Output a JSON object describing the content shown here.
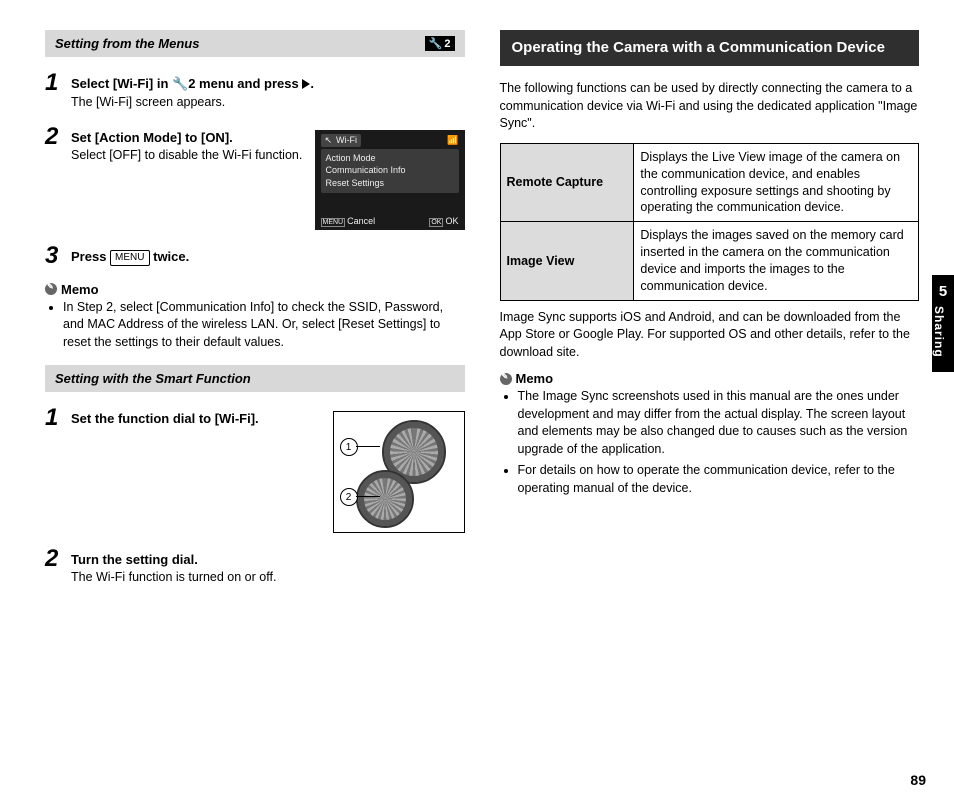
{
  "chapter_number": "5",
  "chapter_name": "Sharing",
  "page_number": "89",
  "left": {
    "section1": {
      "title": "Setting from the Menus",
      "badge_label": "2",
      "steps": [
        {
          "num": "1",
          "title_pre": "Select [Wi-Fi] in ",
          "title_mid": "2 menu and press ",
          "title_post": ".",
          "sub": "The [Wi-Fi] screen appears."
        },
        {
          "num": "2",
          "title": "Set [Action Mode] to [ON].",
          "sub": "Select [OFF] to disable the Wi-Fi function.",
          "lcd": {
            "title": "Wi-Fi",
            "items": [
              "Action Mode",
              "Communication Info",
              "Reset Settings"
            ],
            "cancel": "Cancel",
            "ok": "OK",
            "menu_btn": "MENU",
            "ok_btn": "OK"
          }
        },
        {
          "num": "3",
          "title_pre": "Press ",
          "title_post": " twice.",
          "menu_label": "MENU"
        }
      ],
      "memo_label": "Memo",
      "memo": "In Step 2, select [Communication Info] to check the SSID, Password, and MAC Address of the wireless LAN. Or, select [Reset Settings] to reset the settings to their default values."
    },
    "section2": {
      "title": "Setting with the Smart Function",
      "steps": [
        {
          "num": "1",
          "title": "Set the function dial to [Wi-Fi].",
          "callouts": [
            "1",
            "2"
          ]
        },
        {
          "num": "2",
          "title": "Turn the setting dial.",
          "sub": "The Wi-Fi function is turned on or off."
        }
      ]
    }
  },
  "right": {
    "heading": "Operating the Camera with a Communication Device",
    "intro": "The following functions can be used by directly connecting the camera to a communication device via Wi-Fi and using the dedicated application \"Image Sync\".",
    "features": [
      {
        "name": "Remote Capture",
        "desc": "Displays the Live View image of the camera on the communication device, and enables controlling exposure settings and shooting by operating the communication device."
      },
      {
        "name": "Image View",
        "desc": "Displays the images saved on the memory card inserted in the camera on the communication device and imports the images to the communication device."
      }
    ],
    "after_table": "Image Sync supports iOS and Android, and can be downloaded from the App Store or Google Play. For supported OS and other details, refer to the download site.",
    "memo_label": "Memo",
    "memos": [
      "The Image Sync screenshots used in this manual are the ones under development and may differ from the actual display. The screen layout and elements may be also changed due to causes such as the version upgrade of the application.",
      "For details on how to operate the communication device, refer to the operating manual of the device."
    ]
  }
}
